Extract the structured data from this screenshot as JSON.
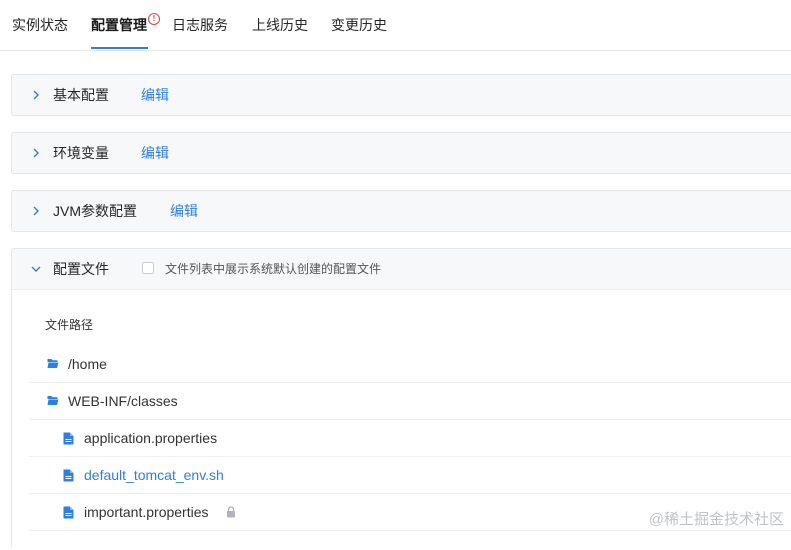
{
  "tabs": [
    {
      "label": "实例状态",
      "active": false
    },
    {
      "label": "配置管理",
      "active": true,
      "badge": "!"
    },
    {
      "label": "日志服务",
      "active": false
    },
    {
      "label": "上线历史",
      "active": false
    },
    {
      "label": "变更历史",
      "active": false
    }
  ],
  "panels": [
    {
      "title": "基本配置",
      "edit_label": "编辑",
      "expanded": false
    },
    {
      "title": "环境变量",
      "edit_label": "编辑",
      "expanded": false
    },
    {
      "title": "JVM参数配置",
      "edit_label": "编辑",
      "expanded": false
    },
    {
      "title": "配置文件",
      "expanded": true,
      "checkbox_label": "文件列表中展示系统默认创建的配置文件",
      "checkbox_checked": false
    }
  ],
  "file_tree": {
    "header": "文件路径",
    "rows": [
      {
        "name": "/home",
        "type": "folder",
        "indent": 0,
        "link": false,
        "locked": false
      },
      {
        "name": "WEB-INF/classes",
        "type": "folder",
        "indent": 0,
        "link": false,
        "locked": false
      },
      {
        "name": "application.properties",
        "type": "file",
        "indent": 1,
        "link": false,
        "locked": false
      },
      {
        "name": "default_tomcat_env.sh",
        "type": "file",
        "indent": 1,
        "link": true,
        "locked": false
      },
      {
        "name": "important.properties",
        "type": "file",
        "indent": 1,
        "link": false,
        "locked": true
      }
    ]
  },
  "watermark": "@稀土掘金技术社区",
  "colors": {
    "accent": "#2f7fe0",
    "alert": "#e0443e",
    "folder_icon": "#2f7fe0",
    "file_icon": "#2f7fe0"
  },
  "icons": {
    "chevron_collapsed": "chevron-right-icon",
    "chevron_expanded": "chevron-down-icon",
    "folder": "folder-open-icon",
    "file": "file-icon",
    "lock": "lock-icon",
    "alert": "alert-circle-icon"
  }
}
